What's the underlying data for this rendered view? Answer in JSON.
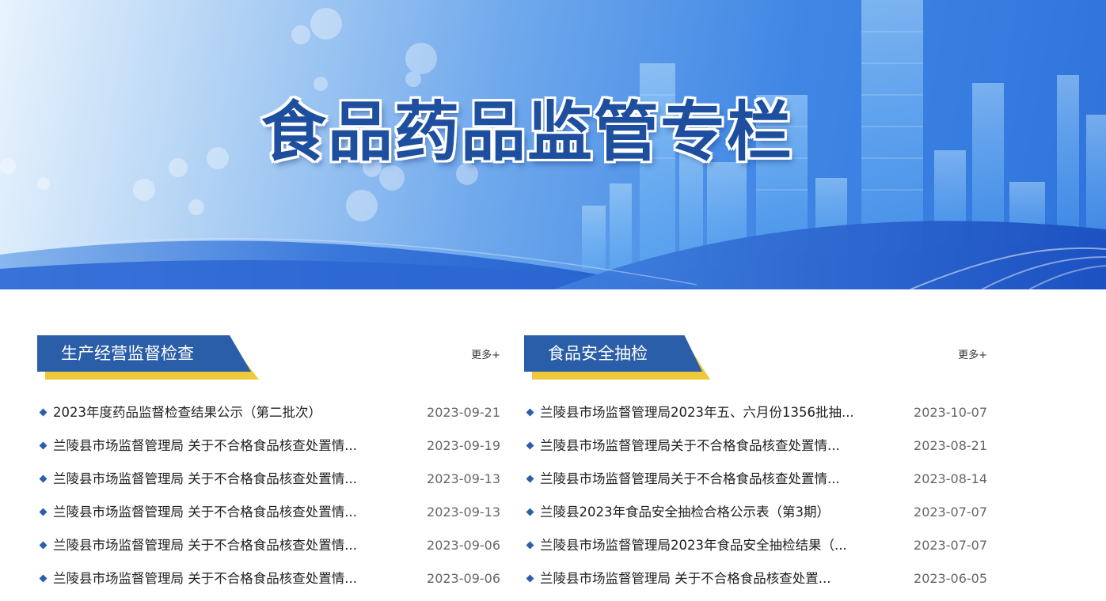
{
  "banner": {
    "title": "食品药品监管专栏"
  },
  "sections": [
    {
      "title": "生产经营监督检查",
      "more": "更多+",
      "items": [
        {
          "title": "2023年度药品监督检查结果公示（第二批次）",
          "date": "2023-09-21"
        },
        {
          "title": "兰陵县市场监督管理局 关于不合格食品核查处置情...",
          "date": "2023-09-19"
        },
        {
          "title": "兰陵县市场监督管理局 关于不合格食品核查处置情...",
          "date": "2023-09-13"
        },
        {
          "title": "兰陵县市场监督管理局 关于不合格食品核查处置情...",
          "date": "2023-09-13"
        },
        {
          "title": "兰陵县市场监督管理局 关于不合格食品核查处置情...",
          "date": "2023-09-06"
        },
        {
          "title": "兰陵县市场监督管理局 关于不合格食品核查处置情...",
          "date": "2023-09-06"
        }
      ]
    },
    {
      "title": "食品安全抽检",
      "more": "更多+",
      "items": [
        {
          "title": "兰陵县市场监督管理局2023年五、六月份1356批抽...",
          "date": "2023-10-07"
        },
        {
          "title": "兰陵县市场监督管理局关于不合格食品核查处置情...",
          "date": "2023-08-21"
        },
        {
          "title": "兰陵县市场监督管理局关于不合格食品核查处置情...",
          "date": "2023-08-14"
        },
        {
          "title": "兰陵县2023年食品安全抽检合格公示表（第3期）",
          "date": "2023-07-07"
        },
        {
          "title": "兰陵县市场监督管理局2023年食品安全抽检结果（...",
          "date": "2023-07-07"
        },
        {
          "title": "兰陵县市场监督管理局 关于不合格食品核查处置...",
          "date": "2023-06-05"
        }
      ]
    }
  ],
  "colors": {
    "primary_blue": "#2b5ea8",
    "accent_yellow": "#f0c93a",
    "title_blue": "#1e4f9f"
  }
}
